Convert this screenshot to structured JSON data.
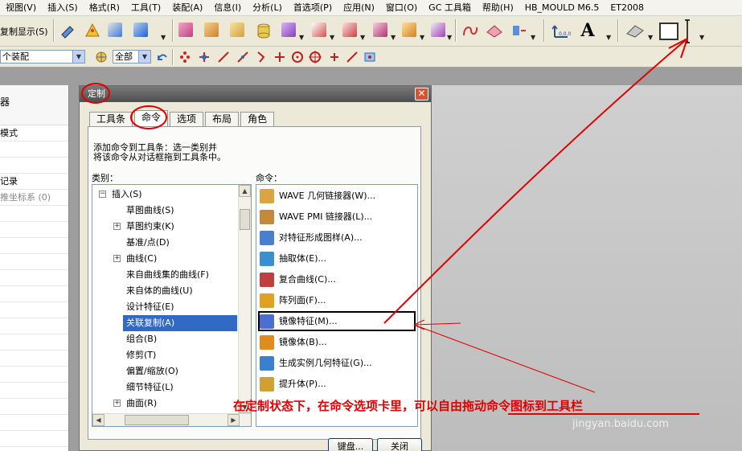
{
  "menubar": {
    "items": [
      "视图(V)",
      "插入(S)",
      "格式(R)",
      "工具(T)",
      "装配(A)",
      "信息(I)",
      "分析(L)",
      "首选项(P)",
      "应用(N)",
      "窗口(O)",
      "GC 工具箱",
      "帮助(H)",
      "HB_MOULD M6.5",
      "ET2008"
    ]
  },
  "toolbar": {
    "partial_label": "复制显示(S)",
    "text_tool": "A"
  },
  "toolbar2": {
    "assembly_select": "个装配",
    "filter_select": "全部"
  },
  "left_panel": {
    "header": "器",
    "rows": [
      "模式",
      "",
      "",
      "记录",
      "推坐标系 (0)",
      "",
      "",
      "",
      "",
      "",
      "",
      "",
      "",
      "",
      "",
      "",
      "",
      "",
      "",
      ""
    ]
  },
  "dialog": {
    "title": "定制",
    "close": "✕",
    "tabs": [
      "工具条",
      "命令",
      "选项",
      "布局",
      "角色"
    ],
    "active_tab": "命令",
    "description_line1": "添加命令到工具条：选一类别并",
    "description_line2": "将该命令从对话框拖到工具条中。",
    "category_label": "类别：",
    "command_label": "命令：",
    "categories": [
      {
        "label": "插入(S)",
        "expand": "−",
        "indent": 0
      },
      {
        "label": "草图曲线(S)",
        "expand": "",
        "indent": 1
      },
      {
        "label": "草图约束(K)",
        "expand": "+",
        "indent": 1
      },
      {
        "label": "基准/点(D)",
        "expand": "",
        "indent": 1
      },
      {
        "label": "曲线(C)",
        "expand": "+",
        "indent": 1
      },
      {
        "label": "来自曲线集的曲线(F)",
        "expand": "",
        "indent": 1
      },
      {
        "label": "来自体的曲线(U)",
        "expand": "",
        "indent": 1
      },
      {
        "label": "设计特征(E)",
        "expand": "",
        "indent": 1
      },
      {
        "label": "关联复制(A)",
        "expand": "",
        "indent": 1,
        "selected": true
      },
      {
        "label": "组合(B)",
        "expand": "",
        "indent": 1
      },
      {
        "label": "修剪(T)",
        "expand": "",
        "indent": 1
      },
      {
        "label": "偏置/缩放(O)",
        "expand": "",
        "indent": 1
      },
      {
        "label": "细节特征(L)",
        "expand": "",
        "indent": 1
      },
      {
        "label": "曲面(R)",
        "expand": "+",
        "indent": 1
      }
    ],
    "commands": [
      {
        "label": "WAVE 几何链接器(W)...",
        "icon": "wave-link-icon",
        "color": "#d9a441"
      },
      {
        "label": "WAVE PMI 链接器(L)...",
        "icon": "wave-pmi-icon",
        "color": "#c28a3a"
      },
      {
        "label": "对特征形成图样(A)...",
        "icon": "pattern-feature-icon",
        "color": "#4a7fd0"
      },
      {
        "label": "抽取体(E)...",
        "icon": "extract-body-icon",
        "color": "#3a8fd0"
      },
      {
        "label": "复合曲线(C)...",
        "icon": "composite-curve-icon",
        "color": "#c04040"
      },
      {
        "label": "阵列面(F)...",
        "icon": "pattern-face-icon",
        "color": "#e0a020"
      },
      {
        "label": "镜像特征(M)...",
        "icon": "mirror-feature-icon",
        "color": "#4a6fd0"
      },
      {
        "label": "镜像体(B)...",
        "icon": "mirror-body-icon",
        "color": "#e08a20"
      },
      {
        "label": "生成实例几何特征(G)...",
        "icon": "instance-geometry-icon",
        "color": "#3a7fd0"
      },
      {
        "label": "提升体(P)...",
        "icon": "promote-body-icon",
        "color": "#d0a030"
      }
    ],
    "buttons": {
      "keyboard": "键盘...",
      "close": "关闭"
    }
  },
  "annotation": {
    "text": "在定制状态下，在命令选项卡里，可以自由拖动命令图标到工具栏",
    "color": "#e00000"
  },
  "watermark": {
    "site": "jingyan.baidu.com"
  }
}
